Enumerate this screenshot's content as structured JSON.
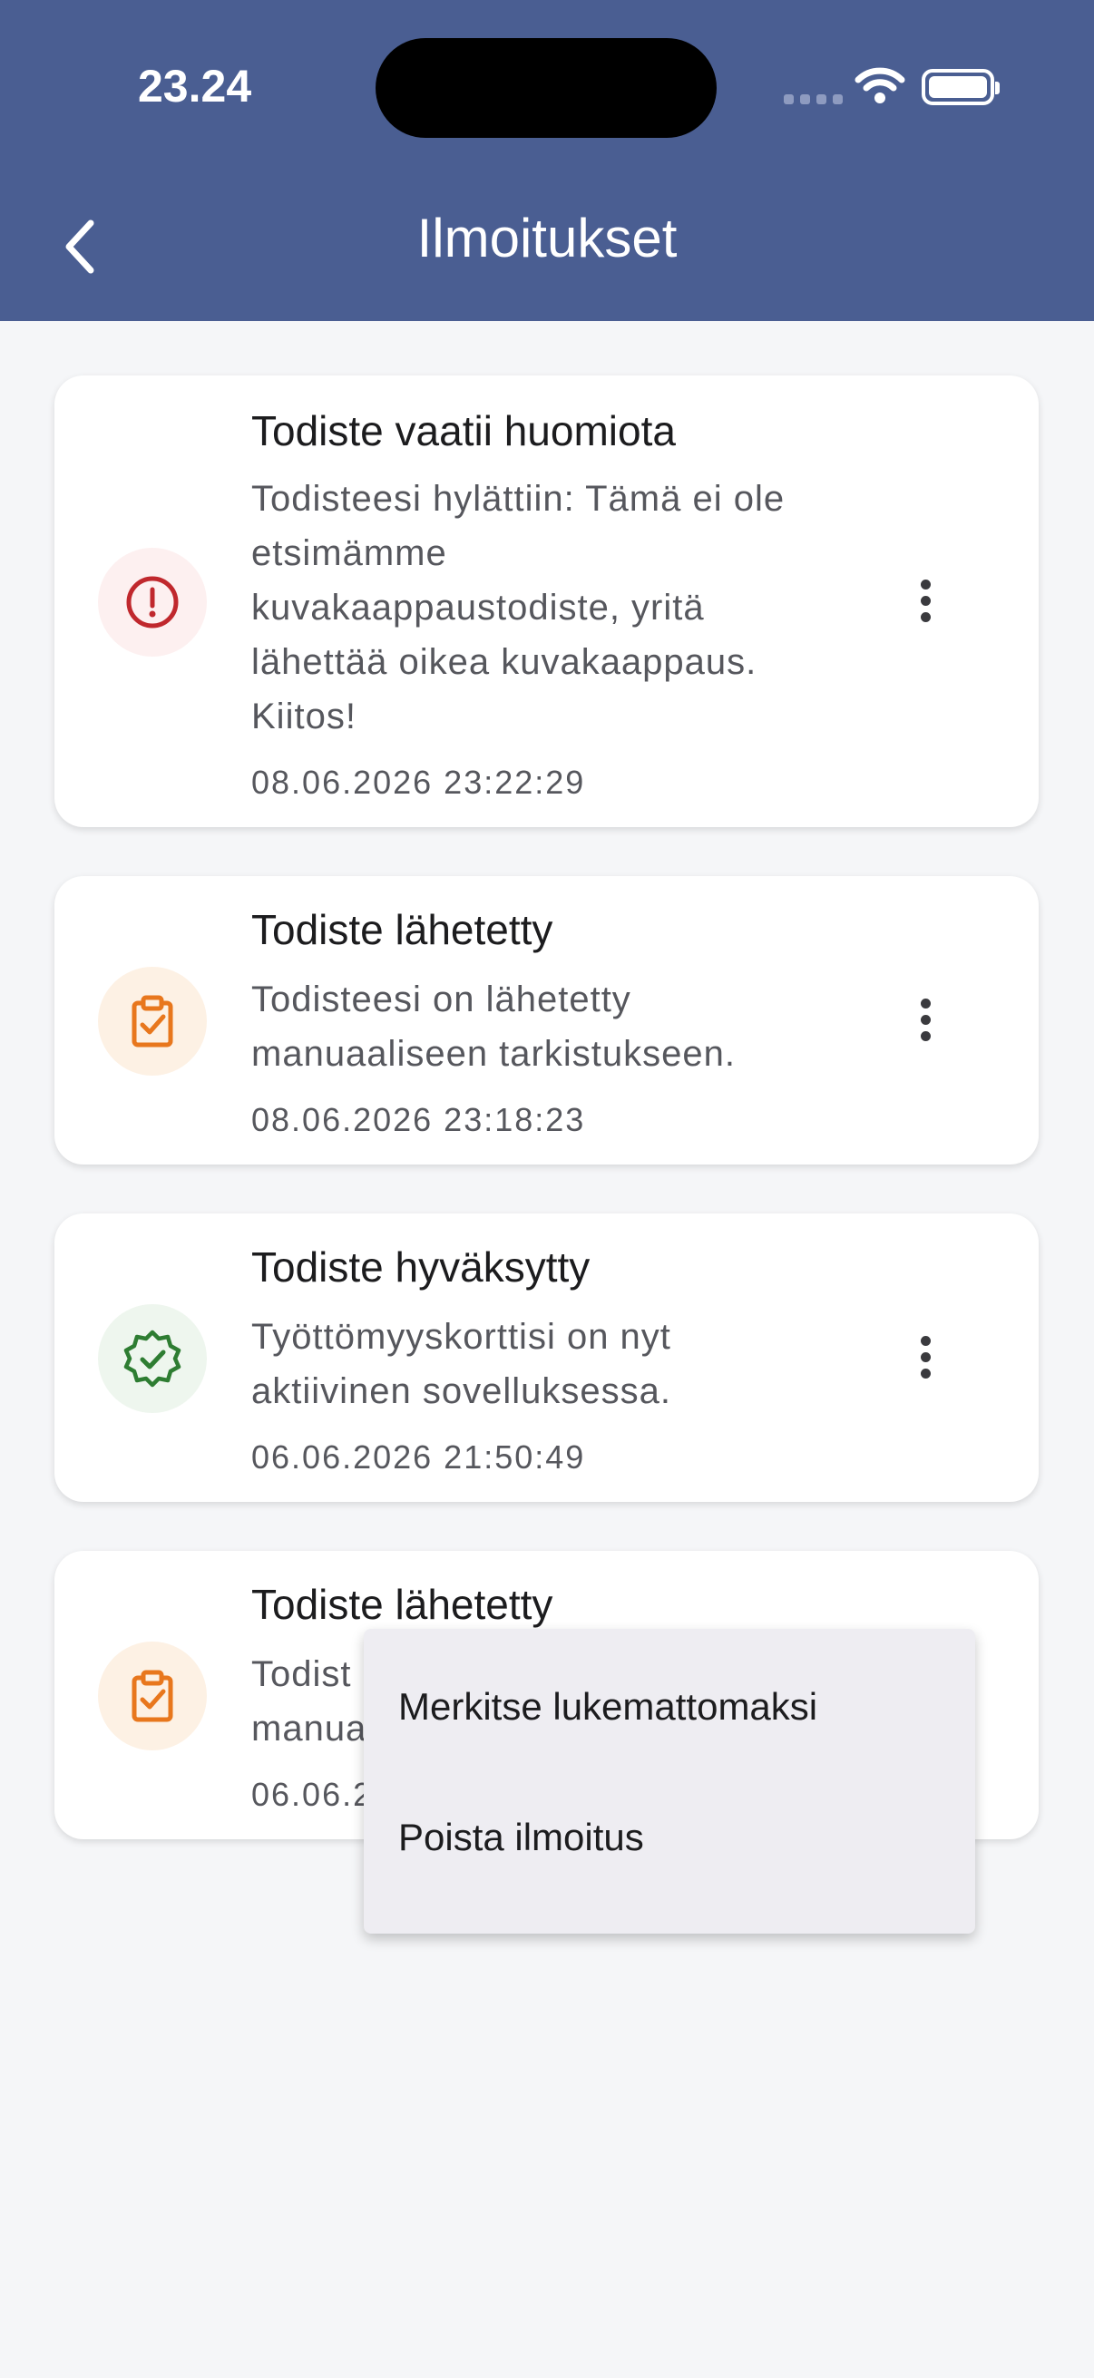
{
  "status_bar": {
    "time": "23.24"
  },
  "header": {
    "title": "Ilmoitukset",
    "back_icon": "chevron-left-icon"
  },
  "notifications": [
    {
      "title": "Todiste vaatii huomiota",
      "body": "Todisteesi hylättiin: Tämä ei ole etsimämme kuvakaappaustodiste, yritä lähettää oikea kuvakaappaus. Kiitos!",
      "date": "08.06.2026 23:22:29",
      "icon": "alert-circle-icon",
      "color": "#c0282d"
    },
    {
      "title": "Todiste lähetetty",
      "body": "Todisteesi on lähetetty manuaaliseen tarkistukseen.",
      "date": "08.06.2026 23:18:23",
      "icon": "clipboard-check-icon",
      "color": "#e8771d"
    },
    {
      "title": "Todiste hyväksytty",
      "body": "Työttömyyskorttisi on nyt aktiivinen sovelluksessa.",
      "date": "06.06.2026 21:50:49",
      "icon": "verified-badge-icon",
      "color": "#2e7d32"
    },
    {
      "title": "Todiste lähetetty",
      "body": "Todist",
      "body_line2": "manua",
      "date": "06.06.2",
      "icon": "clipboard-check-icon",
      "color": "#e8771d"
    }
  ],
  "context_menu": {
    "items": [
      "Merkitse lukemattomaksi",
      "Poista ilmoitus"
    ]
  },
  "colors": {
    "header_bg": "#4a5e92",
    "page_bg": "#f5f6f8"
  }
}
